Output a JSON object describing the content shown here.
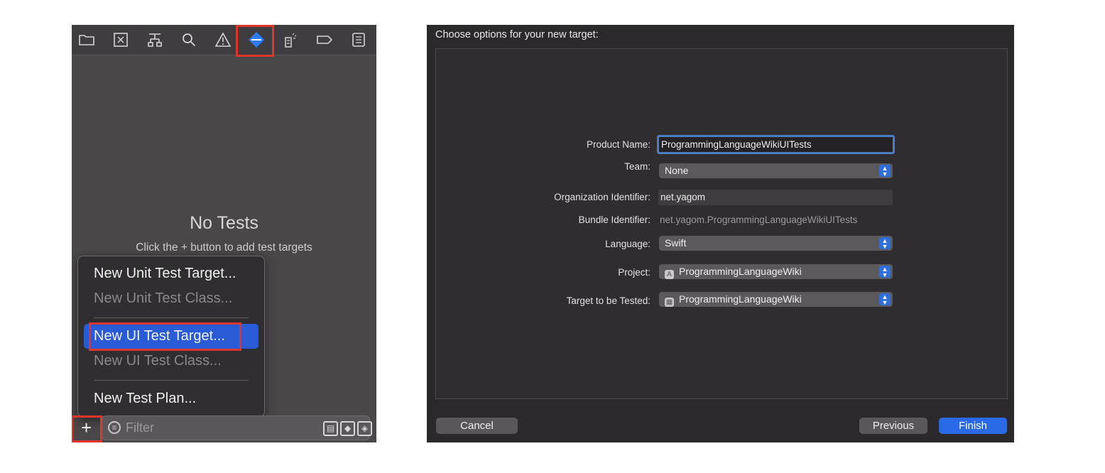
{
  "navigator": {
    "toolbar_icons": [
      "folder-icon",
      "source-control-icon",
      "symbol-icon",
      "search-icon",
      "warning-icon",
      "test-navigator-icon",
      "debug-icon",
      "breakpoint-icon",
      "report-icon"
    ],
    "empty_title": "No Tests",
    "empty_subtitle": "Click the + button to add test targets",
    "menu": {
      "items": [
        {
          "label": "New Unit Test Target...",
          "enabled": true
        },
        {
          "label": "New Unit Test Class...",
          "enabled": false
        },
        {
          "label": "New UI Test Target...",
          "enabled": true,
          "selected": true
        },
        {
          "label": "New UI Test Class...",
          "enabled": false
        },
        {
          "label": "New Test Plan...",
          "enabled": true
        }
      ]
    },
    "bottom_bar": {
      "plus_label": "+",
      "filter_placeholder": "Filter"
    }
  },
  "dialog": {
    "title": "Choose options for your new target:",
    "fields": {
      "product_name": {
        "label": "Product Name:",
        "value": "ProgrammingLanguageWikiUITests"
      },
      "team": {
        "label": "Team:",
        "value": "None"
      },
      "organization_identifier": {
        "label": "Organization Identifier:",
        "value": "net.yagom"
      },
      "bundle_identifier": {
        "label": "Bundle Identifier:",
        "value": "net.yagom.ProgrammingLanguageWikiUITests"
      },
      "language": {
        "label": "Language:",
        "value": "Swift"
      },
      "project": {
        "label": "Project:",
        "value": "ProgrammingLanguageWiki"
      },
      "target_to_be_tested": {
        "label": "Target to be Tested:",
        "value": "ProgrammingLanguageWiki"
      }
    },
    "buttons": {
      "cancel": "Cancel",
      "previous": "Previous",
      "finish": "Finish"
    }
  },
  "colors": {
    "highlight": "#e0352b",
    "accent": "#2a6ae6",
    "selected_menu": "#2a5bd6"
  }
}
